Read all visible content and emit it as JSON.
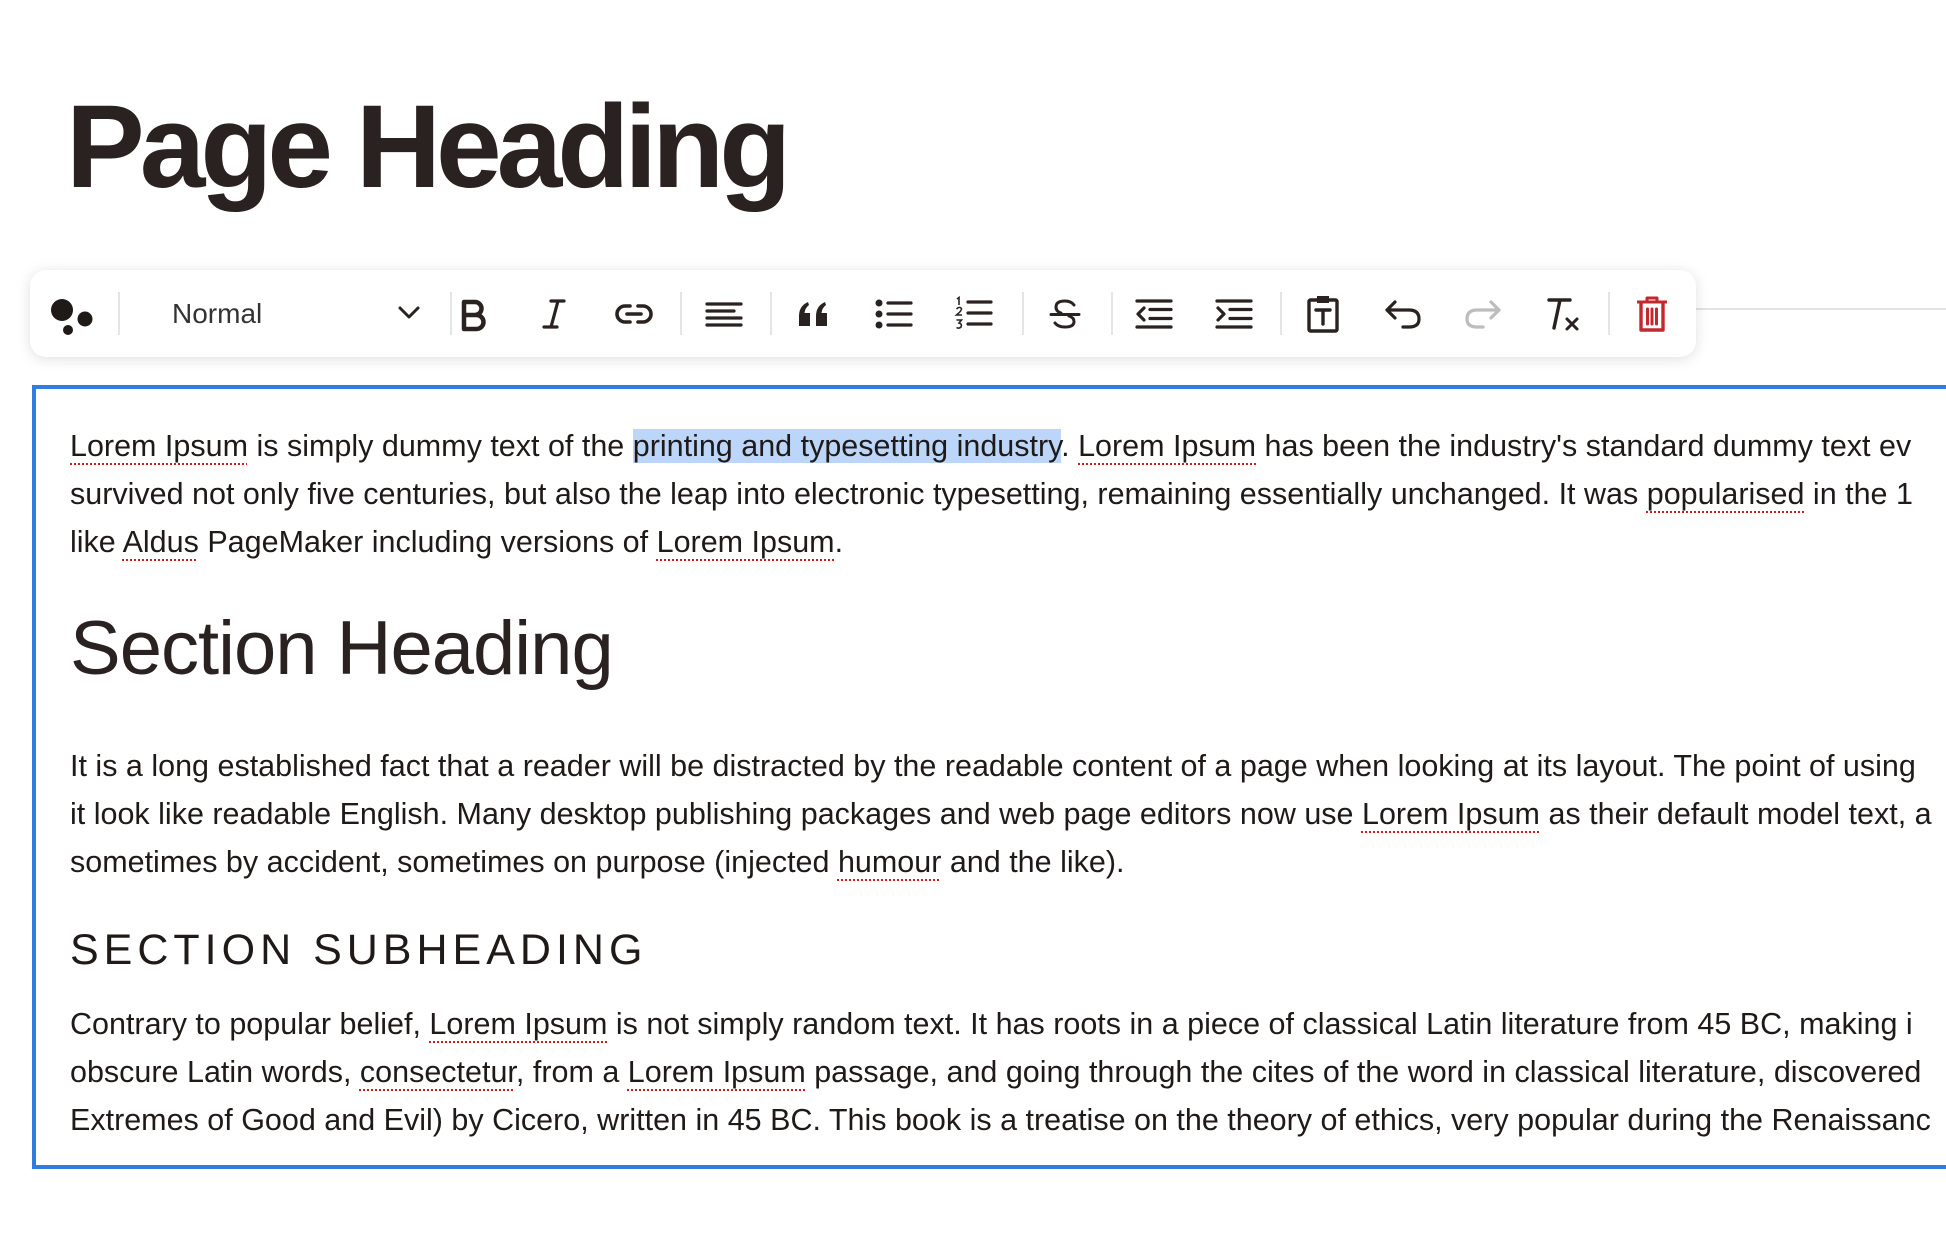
{
  "page": {
    "heading": "Page Heading"
  },
  "toolbar": {
    "style_select": "Normal",
    "buttons": [
      "logo-icon",
      "bold-icon",
      "italic-icon",
      "link-icon",
      "align-left-icon",
      "blockquote-icon",
      "bullet-list-icon",
      "numbered-list-icon",
      "strikethrough-icon",
      "outdent-icon",
      "indent-icon",
      "paste-text-icon",
      "undo-icon",
      "redo-icon",
      "clear-format-icon",
      "trash-icon"
    ],
    "colors": {
      "icon": "#2a2220",
      "disabled": "#bdbdbd",
      "danger": "#c2282e"
    }
  },
  "editor": {
    "border_color": "#2f7de1",
    "selection_color": "#bcd6fa",
    "paragraph1": {
      "line1": {
        "w1": "Lorem Ipsum",
        "t1": " is simply dummy text of the ",
        "selected": "printing and typesetting industry",
        "t2": ". ",
        "w2": "Lorem Ipsum",
        "t3": " has been the industry's standard dummy text ev"
      },
      "line2": {
        "t1": "survived not only five centuries, but also the leap into electronic typesetting, remaining essentially unchanged. It was ",
        "w1": "popularised",
        "t2": " in the 1"
      },
      "line3": {
        "t1": "like ",
        "w1": "Aldus",
        "t2": " PageMaker including versions of ",
        "w2": "Lorem Ipsum",
        "t3": "."
      }
    },
    "section_heading": "Section Heading",
    "paragraph2": {
      "line1": {
        "t1": "It is a long established fact that a reader will be distracted by the readable content of a page when looking at its layout. The point of using"
      },
      "line2": {
        "t1": "it look like readable English. Many desktop publishing packages and web page editors now use ",
        "w1": "Lorem Ipsum",
        "t2": " as their default model text, a"
      },
      "line3": {
        "t1": "sometimes by accident, sometimes on purpose (injected ",
        "w1": "humour",
        "t2": " and the like)."
      }
    },
    "section_subheading": "SECTION SUBHEADING",
    "paragraph3": {
      "line1": {
        "t1": "Contrary to popular belief, ",
        "w1": "Lorem Ipsum",
        "t2": " is not simply random text. It has roots in a piece of classical Latin literature from 45 BC, making i"
      },
      "line2": {
        "t1": "obscure Latin words, ",
        "w1": "consectetur",
        "t2": ", from a ",
        "w2": "Lorem Ipsum",
        "t3": " passage, and going through the cites of the word in classical literature, discovered"
      },
      "line3": {
        "t1": "Extremes of Good and Evil) by Cicero, written in 45 BC. This book is a treatise on the theory of ethics, very popular during the Renaissanc"
      }
    }
  }
}
